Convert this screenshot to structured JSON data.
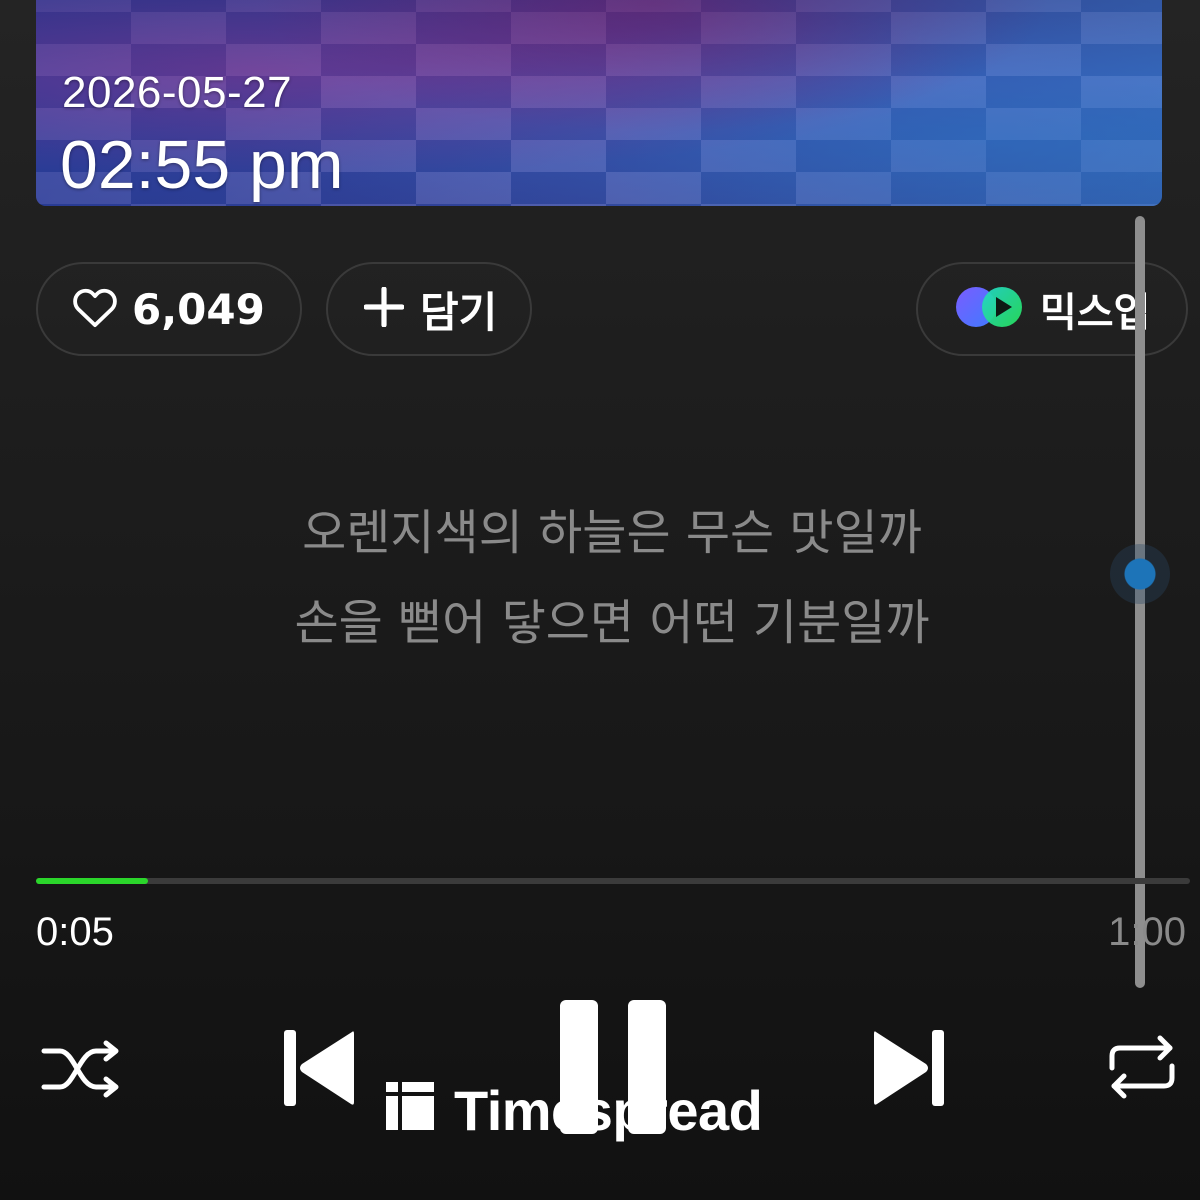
{
  "album": {
    "date": "2026-05-27",
    "time": "02:55 pm"
  },
  "actions": {
    "like_count": "6,049",
    "add_label": "담기",
    "mixup_label": "믹스업"
  },
  "lyrics": {
    "lines": [
      "오렌지색의 하늘은 무슨 맛일까",
      "손을 뻗어 닿으면 어떤 기분일까"
    ]
  },
  "playback": {
    "elapsed": "0:05",
    "duration": "1:00",
    "progress_fraction": 0.097,
    "lyrics_scroll_fraction": 0.5
  },
  "controls": {
    "shuffle_icon": "shuffle-icon",
    "previous_icon": "skip-previous-icon",
    "pause_icon": "pause-icon",
    "next_icon": "skip-next-icon",
    "repeat_icon": "repeat-icon"
  },
  "watermark": {
    "text": "Timespread"
  },
  "colors": {
    "accent": "#2bd62b",
    "scroll_thumb": "#1d74b8",
    "lyrics": "#8a8a8a"
  }
}
